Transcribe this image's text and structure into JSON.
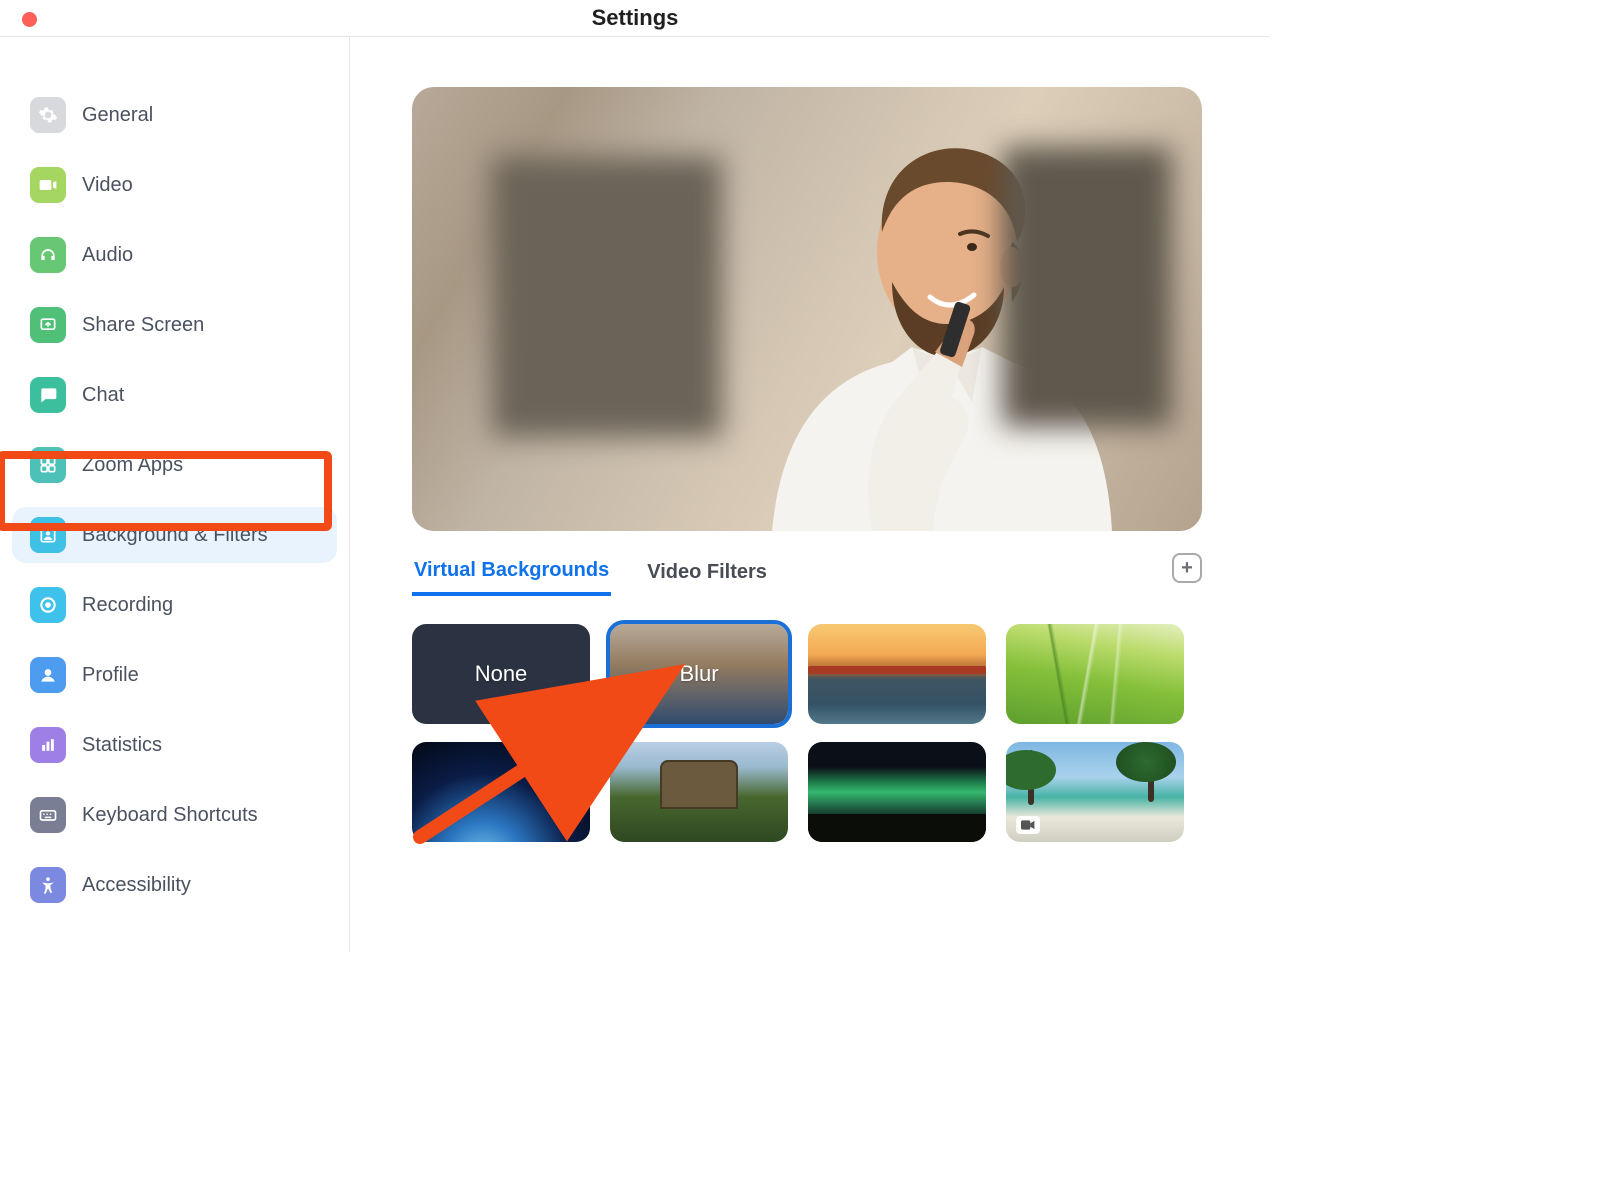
{
  "window": {
    "title": "Settings"
  },
  "sidebar": {
    "items": [
      {
        "label": "General",
        "icon": "gear-icon",
        "bg": "#d8d9dd"
      },
      {
        "label": "Video",
        "icon": "video-icon",
        "bg": "#a6d662"
      },
      {
        "label": "Audio",
        "icon": "headphones-icon",
        "bg": "#68c774"
      },
      {
        "label": "Share Screen",
        "icon": "share-screen-icon",
        "bg": "#50c079"
      },
      {
        "label": "Chat",
        "icon": "chat-icon",
        "bg": "#3bbf9c"
      },
      {
        "label": "Zoom Apps",
        "icon": "apps-icon",
        "bg": "#4dc0b8"
      },
      {
        "label": "Background & Filters",
        "icon": "background-icon",
        "bg": "#3fc0e5",
        "selected": true,
        "highlighted": true
      },
      {
        "label": "Recording",
        "icon": "record-icon",
        "bg": "#3ec2ec"
      },
      {
        "label": "Profile",
        "icon": "profile-icon",
        "bg": "#4e9cf0"
      },
      {
        "label": "Statistics",
        "icon": "stats-icon",
        "bg": "#9e7fe6"
      },
      {
        "label": "Keyboard Shortcuts",
        "icon": "keyboard-icon",
        "bg": "#7a7e94"
      },
      {
        "label": "Accessibility",
        "icon": "accessibility-icon",
        "bg": "#7c89e0"
      }
    ]
  },
  "tabs": {
    "items": [
      {
        "label": "Virtual Backgrounds",
        "active": true
      },
      {
        "label": "Video Filters",
        "active": false
      }
    ],
    "add_button": "+"
  },
  "backgrounds": {
    "tiles": [
      {
        "label": "None",
        "kind": "none"
      },
      {
        "label": "Blur",
        "kind": "blur",
        "selected": true,
        "arrow_target": true
      },
      {
        "label": "",
        "kind": "bridge"
      },
      {
        "label": "",
        "kind": "grass"
      },
      {
        "label": "",
        "kind": "earth"
      },
      {
        "label": "",
        "kind": "jurassic"
      },
      {
        "label": "",
        "kind": "aurora",
        "has_video_badge": true
      },
      {
        "label": "",
        "kind": "beach",
        "has_video_badge": true
      }
    ]
  },
  "annotation": {
    "highlight_color": "#f24a17",
    "arrow_color": "#f24a17"
  }
}
